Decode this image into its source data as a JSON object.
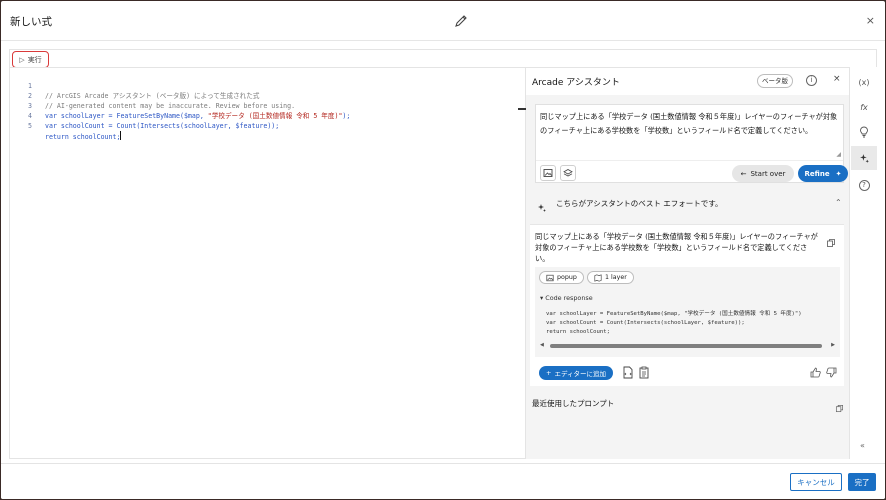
{
  "dialog": {
    "title": "新しい式",
    "close_glyph": "×"
  },
  "toolbar": {
    "run_label": "実行"
  },
  "editor": {
    "lines": [
      {
        "num": "1",
        "text": "// ArcGIS Arcade アシスタント (ベータ版) によって生成された式"
      },
      {
        "num": "2",
        "text": "// AI-generated content may be inaccurate. Review before using."
      },
      {
        "num": "3",
        "kw": "var",
        "ident": " schoolLayer = FeatureSetByName($map, ",
        "str": "\"学校データ (国土数値情報 令和 5 年度)\"",
        "tail": ");"
      },
      {
        "num": "4",
        "kw": "var",
        "ident": " schoolCount = Count(Intersects(schoolLayer, $feature));"
      },
      {
        "num": "5",
        "kw": "return",
        "ident": " schoolCount;"
      }
    ]
  },
  "assistant": {
    "title": "Arcade アシスタント",
    "beta_label": "ベータ版",
    "info_glyph": "i",
    "close_glyph": "×",
    "prompt_text": "同じマップ上にある「学校データ (国土数値情報 令和５年度)」レイヤーのフィーチャが対象のフィーチャ上にある学校数を「学校数」というフィールド名で定義してください。",
    "start_over_label": "Start over",
    "refine_label": "Refine",
    "best_effort_label": "こちらがアシスタントのベスト エフォートです。",
    "result_text": "同じマップ上にある「学校データ (国土数値情報 令和５年度)」レイヤーのフィーチャが対象のフィーチャ上にある学校数を「学校数」というフィールド名で定義してください。",
    "chip_popup": "popup",
    "chip_layer": "1 layer",
    "code_response_label": "▾ Code response",
    "code_lines": [
      "var schoolLayer = FeatureSetByName($map, \"学校データ (国土数値情報 令和 5 年度)\")",
      "var schoolCount = Count(Intersects(schoolLayer, $feature));",
      "return schoolCount;"
    ],
    "add_to_editor_label": "エディターに追加",
    "recent_prompts_label": "最近使用したプロンプト"
  },
  "rail": {
    "items": [
      {
        "name": "variables",
        "glyph": "(x)"
      },
      {
        "name": "functions",
        "glyph": "fx"
      },
      {
        "name": "suggestions",
        "glyph": "💡"
      },
      {
        "name": "assistant",
        "glyph": "✦"
      },
      {
        "name": "help",
        "glyph": "?"
      }
    ],
    "collapse_glyph": "«"
  },
  "footer": {
    "cancel_label": "キャンセル",
    "done_label": "完了"
  },
  "colors": {
    "accent": "#1a6fc4",
    "run_highlight": "#d93a3a",
    "keyword": "#2b55c4",
    "string": "#b3261e",
    "comment": "#7c7c7c"
  }
}
